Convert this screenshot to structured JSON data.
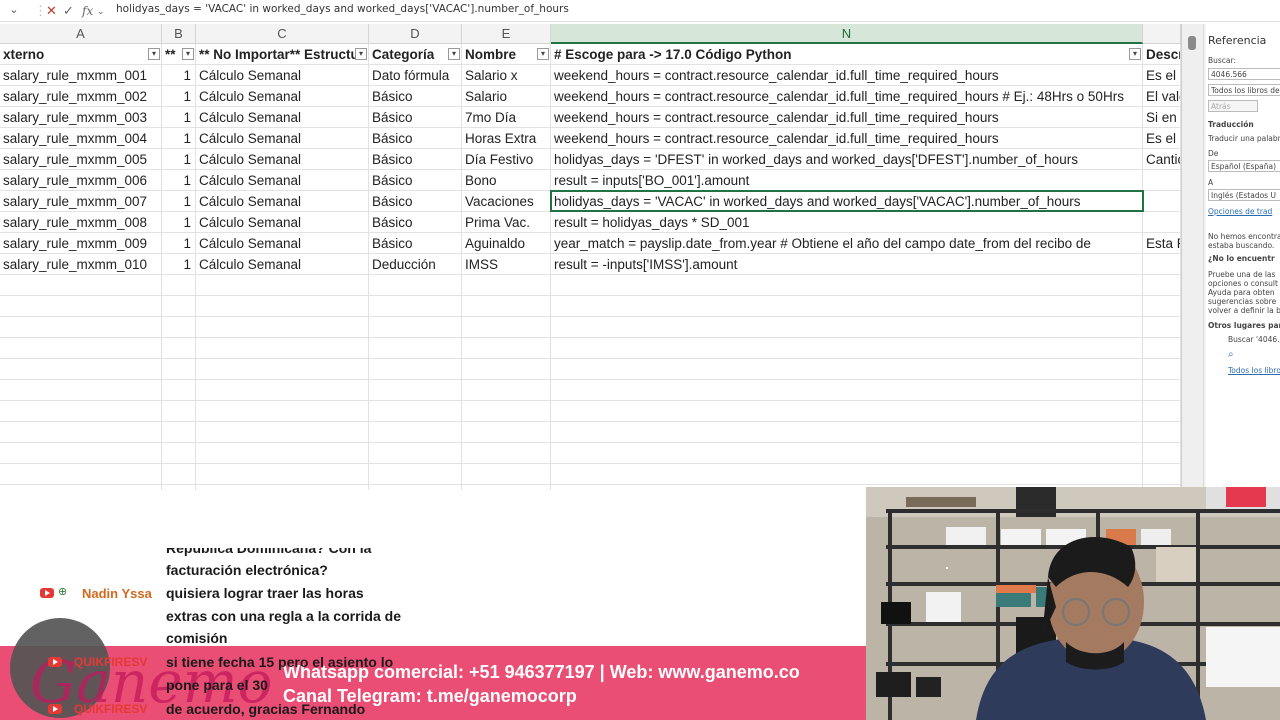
{
  "formula_bar": {
    "namebox": "⌄",
    "fx_label": "fx",
    "formula": "holidyas_days = 'VACAC' in worked_days and worked_days['VACAC'].number_of_hours"
  },
  "columns": [
    "A",
    "B",
    "C",
    "D",
    "E",
    "N"
  ],
  "table": {
    "headers": [
      "xterno",
      "**",
      "** No Importar** Estructu",
      "Categoría",
      "Nombre",
      "# Escoge para -> 17.0 Código Python",
      "Descr"
    ],
    "rows": [
      [
        "salary_rule_mxmm_001",
        "1",
        "Cálculo Semanal",
        "Dato fórmula",
        "Salario x",
        "weekend_hours = contract.resource_calendar_id.full_time_required_hours",
        "Es el S"
      ],
      [
        "salary_rule_mxmm_002",
        "1",
        "Cálculo Semanal",
        "Básico",
        "Salario",
        "weekend_hours = contract.resource_calendar_id.full_time_required_hours # Ej.: 48Hrs o 50Hrs",
        "El valo"
      ],
      [
        "salary_rule_mxmm_003",
        "1",
        "Cálculo Semanal",
        "Básico",
        "7mo Día",
        "weekend_hours = contract.resource_calendar_id.full_time_required_hours",
        "Si en"
      ],
      [
        "salary_rule_mxmm_004",
        "1",
        "Cálculo Semanal",
        "Básico",
        "Horas Extra",
        "weekend_hours = contract.resource_calendar_id.full_time_required_hours",
        "Es el r"
      ],
      [
        "salary_rule_mxmm_005",
        "1",
        "Cálculo Semanal",
        "Básico",
        "Día Festivo",
        "holidyas_days = 'DFEST' in worked_days and worked_days['DFEST'].number_of_hours",
        "Cantic"
      ],
      [
        "salary_rule_mxmm_006",
        "1",
        "Cálculo Semanal",
        "Básico",
        "Bono",
        "result = inputs['BO_001'].amount",
        ""
      ],
      [
        "salary_rule_mxmm_007",
        "1",
        "Cálculo Semanal",
        "Básico",
        "Vacaciones",
        "holidyas_days = 'VACAC' in worked_days and worked_days['VACAC'].number_of_hours",
        ""
      ],
      [
        "salary_rule_mxmm_008",
        "1",
        "Cálculo Semanal",
        "Básico",
        "Prima Vac.",
        "result = holidyas_days * SD_001",
        ""
      ],
      [
        "salary_rule_mxmm_009",
        "1",
        "Cálculo Semanal",
        "Básico",
        "Aguinaldo",
        "year_match = payslip.date_from.year # Obtiene el año del campo date_from del recibo de",
        "Esta R"
      ],
      [
        "salary_rule_mxmm_010",
        "1",
        "Cálculo Semanal",
        "Deducción",
        "IMSS",
        "result = -inputs['IMSS'].amount",
        ""
      ]
    ]
  },
  "reference_pane": {
    "title": "Referencia",
    "search_label": "Buscar:",
    "search_value": "4046.566",
    "scope": "Todos los libros de",
    "back": "Atrás",
    "section_translation": "Traducción",
    "translate_text": "Traducir una palabr",
    "from_label": "De",
    "from_value": "Español (España)",
    "to_label": "A",
    "to_value": "Inglés (Estados U",
    "options_link": "Opciones de trad",
    "not_found_1": "No hemos encontra",
    "not_found_2": "estaba buscando.",
    "section_help": "¿No lo encuentr",
    "help_1": "Pruebe una de las",
    "help_2": "opciones o consult",
    "help_3": "Ayuda para obten",
    "help_4": "sugerencias sobre",
    "help_5": "volver a definir la b",
    "other_places": "Otros lugares par",
    "search_other": "Buscar '4046.5",
    "all_books_link": "Todos los libro"
  },
  "chat": {
    "partial_top": "República Dominicana? Con la",
    "line1": "facturación electrónica?",
    "author1": "Nadin Yssa",
    "line2": "quisiera lograr traer las horas",
    "line3": "extras con una regla a la corrida de",
    "line4": "comisión",
    "author2": "QUIKFIRESV",
    "line5": "si tiene fecha 15 pero el asiento lo",
    "line6": "pone para el 30",
    "author3": "QUIKFIRESV",
    "line7": "de acuerdo, gracias Fernando"
  },
  "banner": {
    "line1": "Whatsapp comercial: +51 946377197 | Web: www.ganemo.co",
    "line2": "Canal Telegram: t.me/ganemocorp"
  },
  "logo": {
    "text": "Ganemo"
  },
  "colors": {
    "accent": "#217346",
    "banner": "#ea4e74",
    "author_nadin": "#d2691e",
    "author_quik": "#e53935"
  }
}
